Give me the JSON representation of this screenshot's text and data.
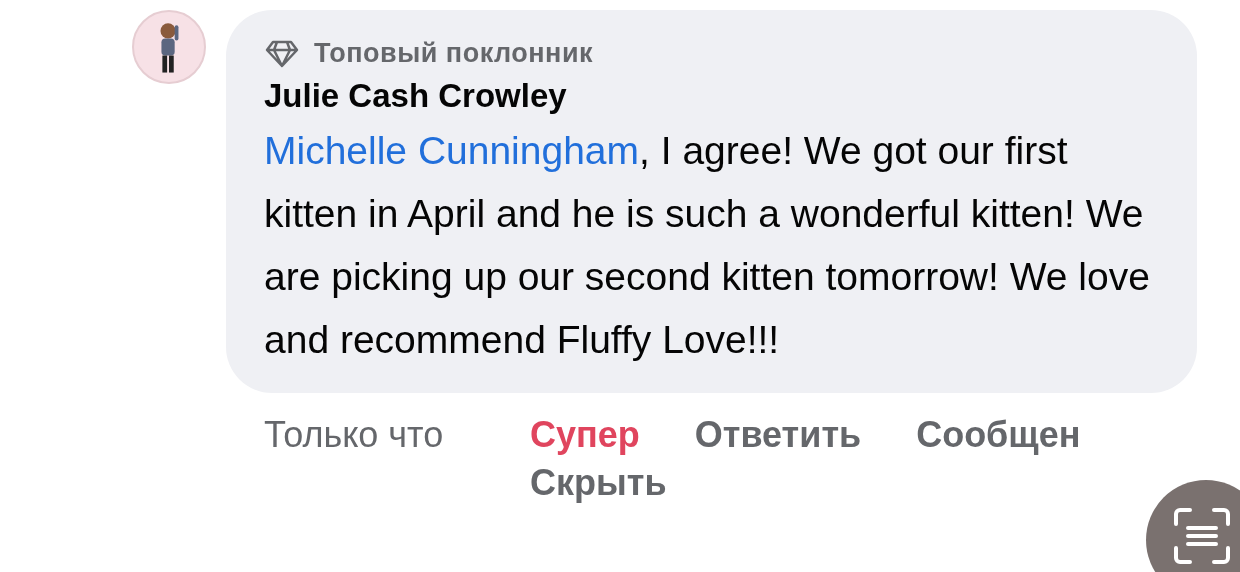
{
  "comment": {
    "badge": "Топовый поклонник",
    "author": "Julie Cash Crowley",
    "mention": "Michelle Cunningham",
    "text": ", I agree! We got our first kitten in April and he is such a wonderful kitten! We are picking up our second kitten tomorrow! We love and recommend Fluffy Love!!!"
  },
  "time": "Только что",
  "actions": [
    {
      "label": "Супер",
      "selected": true
    },
    {
      "label": "Ответить",
      "selected": false
    },
    {
      "label": "Сообщен",
      "selected": false
    },
    {
      "label": "Скрыть",
      "selected": false
    }
  ]
}
